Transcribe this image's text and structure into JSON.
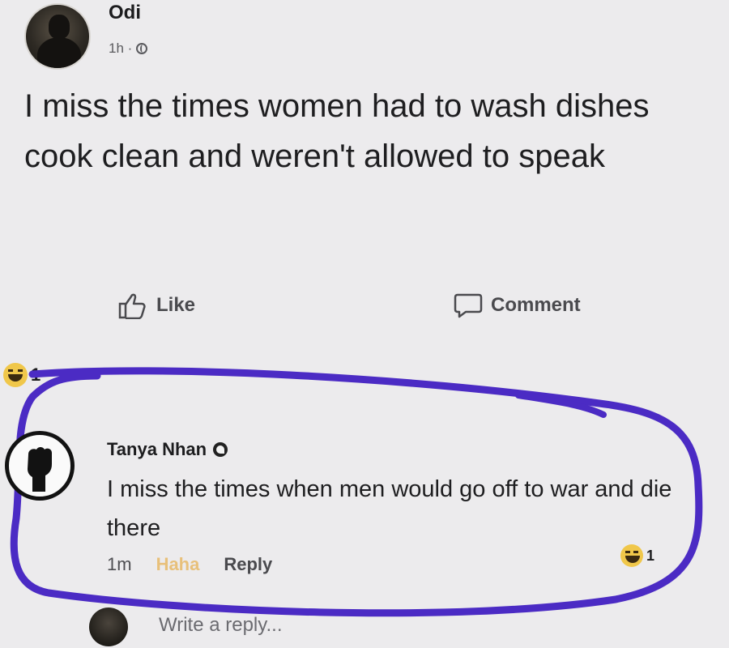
{
  "post": {
    "author": "Odi",
    "time": "1h ·",
    "text": "I miss the times women had to wash dishes cook clean and weren't allowed to speak",
    "actions": {
      "like_label": "Like",
      "comment_label": "Comment"
    },
    "reaction_count": "1"
  },
  "comment": {
    "author": "Tanya Nhan",
    "text": "I miss the times when men would go off to war and die there",
    "time": "1m",
    "haha_label": "Haha",
    "reply_label": "Reply",
    "reaction_count": "1"
  },
  "reply_box": {
    "placeholder": "Write a reply..."
  },
  "colors": {
    "background": "#ecebed",
    "scribble": "#4b2bc4",
    "haha_emoji": "#f0c74a"
  }
}
